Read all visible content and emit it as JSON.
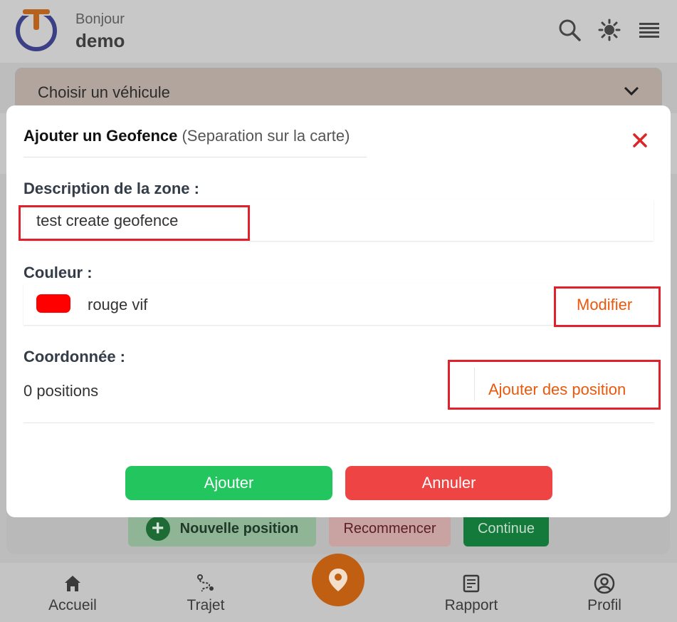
{
  "header": {
    "greeting": "Bonjour",
    "username": "demo"
  },
  "vehicle_select": {
    "label": "Choisir un véhicule"
  },
  "background_actions": {
    "new_position": "Nouvelle position",
    "restart": "Recommencer",
    "continue": "Continue"
  },
  "bottom_nav": {
    "items": [
      {
        "label": "Accueil",
        "icon": "home-icon"
      },
      {
        "label": "Trajet",
        "icon": "route-icon"
      },
      {
        "label": "",
        "icon": "map-pin-icon"
      },
      {
        "label": "Rapport",
        "icon": "report-icon"
      },
      {
        "label": "Profil",
        "icon": "user-circle-icon"
      }
    ]
  },
  "modal": {
    "title": "Ajouter un Geofence",
    "subtitle": "(Separation sur la carte)",
    "description_label": "Description de la zone :",
    "description_value": "test create geofence",
    "color_label": "Couleur :",
    "color_name": "rouge vif",
    "color_value": "#ff0000",
    "modify_label": "Modifier",
    "coords_label": "Coordonnée :",
    "positions_count": "0 positions",
    "add_positions_label": "Ajouter des position",
    "add_button": "Ajouter",
    "cancel_button": "Annuler"
  },
  "colors": {
    "accent_orange": "#ea580c",
    "success_green": "#22c55e",
    "danger_red": "#ef4444",
    "highlight_red": "#e0202a"
  }
}
